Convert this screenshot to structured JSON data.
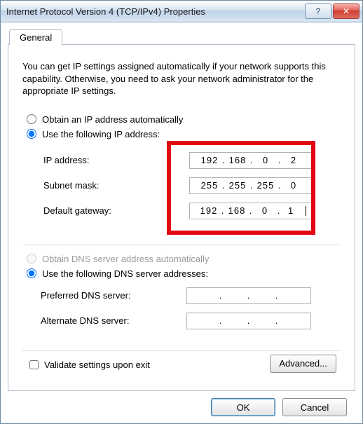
{
  "window": {
    "title": "Internet Protocol Version 4 (TCP/IPv4) Properties",
    "help_icon": "?",
    "close_icon": "✕"
  },
  "tab": {
    "general": "General"
  },
  "description": "You can get IP settings assigned automatically if your network supports this capability. Otherwise, you need to ask your network administrator for the appropriate IP settings.",
  "ip": {
    "auto_label": "Obtain an IP address automatically",
    "manual_label": "Use the following IP address:",
    "addr_label": "IP address:",
    "mask_label": "Subnet mask:",
    "gw_label": "Default gateway:",
    "addr": {
      "o1": "192",
      "o2": "168",
      "o3": "0",
      "o4": "2"
    },
    "mask": {
      "o1": "255",
      "o2": "255",
      "o3": "255",
      "o4": "0"
    },
    "gw": {
      "o1": "192",
      "o2": "168",
      "o3": "0",
      "o4": "1"
    }
  },
  "dns": {
    "auto_label": "Obtain DNS server address automatically",
    "manual_label": "Use the following DNS server addresses:",
    "pref_label": "Preferred DNS server:",
    "alt_label": "Alternate DNS server:",
    "pref": {
      "o1": "",
      "o2": "",
      "o3": "",
      "o4": ""
    },
    "alt": {
      "o1": "",
      "o2": "",
      "o3": "",
      "o4": ""
    }
  },
  "validate_label": "Validate settings upon exit",
  "advanced_label": "Advanced...",
  "ok_label": "OK",
  "cancel_label": "Cancel",
  "dot": "."
}
